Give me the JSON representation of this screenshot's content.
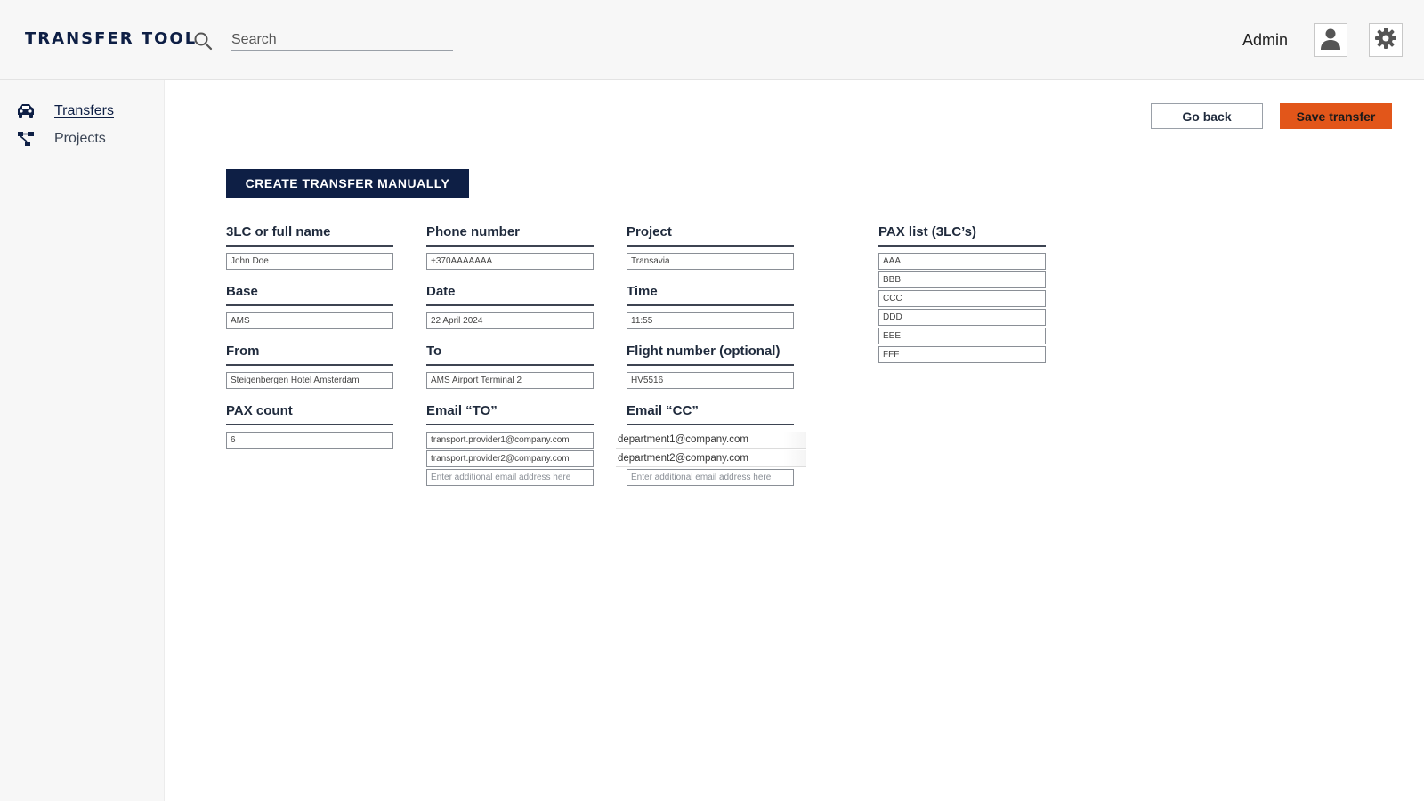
{
  "app": {
    "title": "TRANSFER TOOL"
  },
  "search": {
    "placeholder": "Search"
  },
  "user": {
    "name": "Admin"
  },
  "icons": {
    "search": "search-icon",
    "avatar": "user-icon",
    "settings": "gear-icon",
    "transfers": "car-icon",
    "projects": "network-icon"
  },
  "sidebar": {
    "items": [
      {
        "label": "Transfers",
        "active": true
      },
      {
        "label": "Projects",
        "active": false
      }
    ]
  },
  "actions": {
    "back_label": "Go back",
    "save_label": "Save transfer"
  },
  "colors": {
    "navy": "#0e1f45",
    "accent": "#e2561a"
  },
  "form": {
    "title": "CREATE TRANSFER MANUALLY",
    "name": {
      "label": "3LC or full name",
      "value": "John Doe"
    },
    "phone": {
      "label": "Phone number",
      "value": "+370AAAAAAA"
    },
    "project": {
      "label": "Project",
      "value": "Transavia"
    },
    "base": {
      "label": "Base",
      "value": "AMS"
    },
    "date": {
      "label": "Date",
      "value": "22 April 2024"
    },
    "time": {
      "label": "Time",
      "value": "11:55"
    },
    "from": {
      "label": "From",
      "value": "Steigenbergen Hotel Amsterdam"
    },
    "to": {
      "label": "To",
      "value": "AMS Airport Terminal 2"
    },
    "flight": {
      "label": "Flight number (optional)",
      "value": "HV5516"
    },
    "pax_count": {
      "label": "PAX count",
      "value": "6"
    },
    "email_to": {
      "label": "Email “TO”",
      "values": [
        "transport.provider1@company.com",
        "transport.provider2@company.com"
      ],
      "placeholder": "Enter additional email address here"
    },
    "email_cc": {
      "label": "Email “CC”",
      "values": [
        "department1@company.com",
        "department2@company.com"
      ],
      "placeholder": "Enter additional email address here"
    },
    "pax_list": {
      "label": "PAX list (3LC’s)",
      "values": [
        "AAA",
        "BBB",
        "CCC",
        "DDD",
        "EEE",
        "FFF"
      ]
    }
  }
}
